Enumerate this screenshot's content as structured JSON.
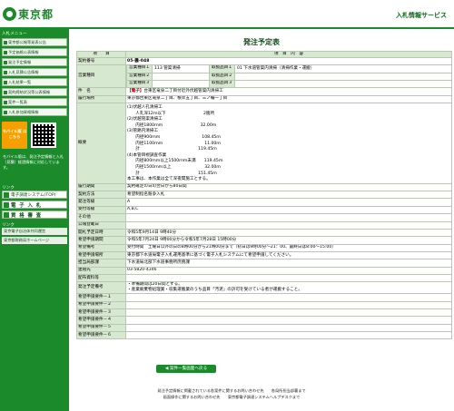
{
  "header": {
    "logo_text": "東京都",
    "service_title": "入札情報サービス"
  },
  "sidebar": {
    "menu_heading": "入札メニュー",
    "items": [
      {
        "label": "東京都公報等発表公告"
      },
      {
        "label": "予定価格公表情報"
      },
      {
        "label": "発注予定情報"
      },
      {
        "label": "入札見積公告情報"
      },
      {
        "label": "入札結果一覧"
      },
      {
        "label": "契約締結状況等公表情報"
      },
      {
        "label": "案件一覧表"
      },
      {
        "label": "入札参加資格情報"
      }
    ],
    "mobile_button": "モバイル版 はこちら",
    "mobile_note": "モバイル版は、発注予定情報と入札（見積）経過情報に対応しています。",
    "links_heading": "リンク",
    "big_links": [
      {
        "label": "電子調達システム(TOP)"
      },
      {
        "label": "電 子 入 札"
      },
      {
        "label": "資 格 審 査"
      }
    ],
    "other_heading": "リンク",
    "small_links": [
      {
        "label": "東京電子自治体共同運営"
      },
      {
        "label": "東京都財務局ホームページ"
      }
    ]
  },
  "page": {
    "title": "発注予定表",
    "col_item": "項　　目",
    "col_content": "項　目　内　容",
    "back_button": "案件一覧画面へ戻る"
  },
  "record": {
    "contract_no_label": "契約番号",
    "contract_no": "05-醤-048",
    "business_type_label": "営業種目",
    "business_1_label": "営業種目１",
    "business_1": "113 管渠清掃",
    "item_1_label": "取扱品目１",
    "item_1": "01 下水道管渠内清掃（清掃作業・運搬）",
    "business_2_label": "営業種目２",
    "item_2_label": "取扱品目２",
    "business_3_label": "営業種目３",
    "item_3_label": "取扱品目３",
    "name_label": "件　名",
    "name_tag": "【電子】",
    "name": "台東区竜泉二丁目付近外伏越管渠内清掃工",
    "location_label": "履行場所",
    "location": "東京都台東区竜泉二丁目、根岸五丁目、三ノ輪一丁目",
    "overview_label": "概要",
    "overview_lines": [
      "(1)伏越人孔清掃工",
      "　　人孔深12ｍ以下　　　　　　　　　2箇所",
      "(2)伏越管渠清掃工",
      "　　内径1800ｍｍ　　　　　　　　　32.00ｍ",
      "(3)管路内清掃工",
      "　　内径900ｍｍ　　　　　　　　　　108.45ｍ",
      "　　内径1100ｍｍ　　　　　　　　　　11.00ｍ",
      "　　計　　　　　　　　　　　　　　119.45ｍ",
      "(4)本管目視調査作業",
      "　　内径800ｍｍ以上1500ｍｍ未満　　119.45ｍ",
      "　　内径1500ｍｍ以上　　　　　　　　32.00ｍ",
      "　　計　　　　　　　　　　　　　　151.45ｍ",
      "本工事は、本作業は全て深夜間施工とする。"
    ],
    "period_label": "履行期間",
    "period": "契約確定の日の翌日から80日間",
    "method_label": "契約方法",
    "method": "希望制指名競争入札",
    "grade_label": "発注等級",
    "grade": "A",
    "accept_grade_label": "受付等級",
    "accept_grade": "A,B,C",
    "other_label": "その他",
    "pub_date_label": "公報登載日",
    "pub_date": "",
    "open_date_label": "開札予定日時",
    "open_date": "令和5年9月14日 9時40分",
    "hope_period_label": "希望申請期間",
    "hope_period": "令和5年7月24日 9時00分から令和5年7月28日 15時00分",
    "hope_note_label": "希望備考",
    "hope_note": "受付時間　土曜日以外の日の8時00分から21時00分まで（初日は9時00分～21：00、最終日は8:00～15:00）",
    "hope_place_label": "希望申請場所",
    "hope_place": "東京都下水道局電子入札運用基準に基づく電子入札システムにて希望申請してください。",
    "dept_label": "担当局部課",
    "dept": "下水道局北部下水道事務所庶務課",
    "contact_label": "連絡先",
    "contact": "03-5820-4346",
    "staff_label": "配布資料等",
    "staff": "",
    "conditions_label": "発注予定備考",
    "conditions_lines": [
      "・準備期間は20日間とする。",
      "・産業廃棄物処理業・収集運搬業のうち品目「汚泥」の許可を受けている者が運搬すること。"
    ],
    "req_labels": [
      "希望申請要件－１",
      "希望申請要件－２",
      "希望申請要件－３",
      "希望申請要件－４",
      "希望申請要件－５",
      "希望申請要件－６"
    ]
  },
  "footer": {
    "line1": "発注予定情報に掲載されている各案件に関するお問い合わせ先　　各局所担当部署まで",
    "line2": "画面操作に関するお問い合わせ先　　東京都電子調達システムヘルプデスクまで"
  },
  "colors": {
    "brand_green": "#1a8a2a",
    "label_bg": "#d7e8d0",
    "mobile_orange": "#f5a000",
    "electronic_tag": "#cc0000"
  }
}
